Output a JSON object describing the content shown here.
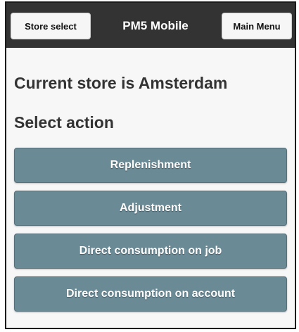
{
  "header": {
    "left_button": "Store select",
    "title": "PM5 Mobile",
    "right_button": "Main Menu"
  },
  "main": {
    "current_store_text": "Current store is Amsterdam",
    "select_action_heading": "Select action",
    "actions": [
      {
        "label": "Replenishment"
      },
      {
        "label": "Adjustment"
      },
      {
        "label": "Direct consumption on job"
      },
      {
        "label": "Direct consumption on account"
      }
    ]
  },
  "colors": {
    "header_bg": "#333333",
    "action_button_bg": "#6a8a96",
    "page_bg": "#f7f7f7"
  }
}
